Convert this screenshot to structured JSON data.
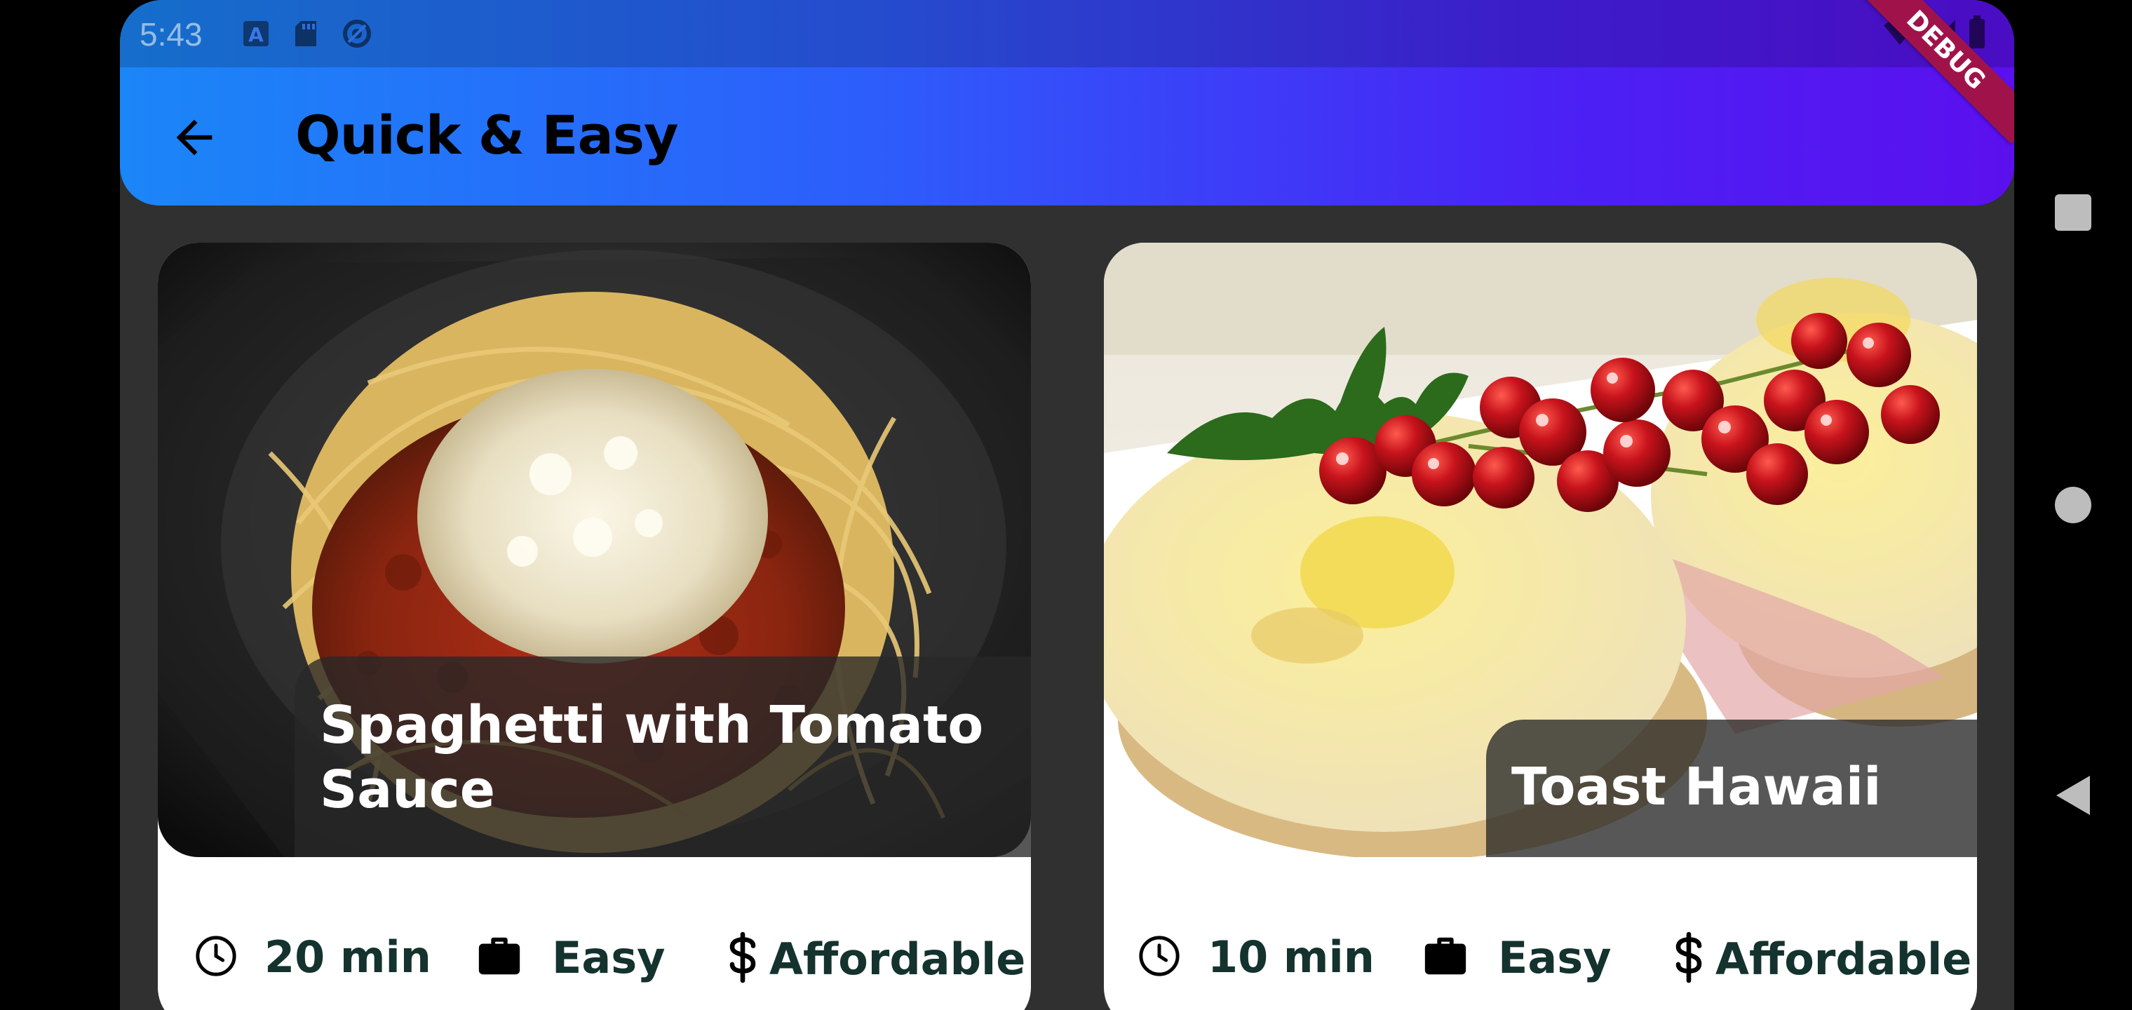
{
  "status_bar": {
    "time": "5:43",
    "left_icons": [
      "text-a-icon",
      "sd-card-icon",
      "sync-icon"
    ],
    "right_icons": [
      "wifi-icon",
      "signal-icon",
      "battery-icon"
    ]
  },
  "app_bar": {
    "title": "Quick & Easy",
    "back_icon": "arrow-left-icon",
    "debug_banner": "DEBUG"
  },
  "meals": [
    {
      "title": "Spaghetti with Tomato Sauce",
      "duration": "20 min",
      "complexity": "Easy",
      "affordability": "Affordable",
      "image": "spaghetti-photo"
    },
    {
      "title": "Toast Hawaii",
      "duration": "10 min",
      "complexity": "Easy",
      "affordability": "Affordable",
      "image": "toast-hawaii-photo"
    }
  ],
  "navigation": [
    "recents-button",
    "home-button",
    "back-button"
  ],
  "colors": {
    "app_bar_start": "#1b86f8",
    "app_bar_end": "#5b10ee",
    "background": "#303030",
    "meta_text": "#14322e"
  }
}
